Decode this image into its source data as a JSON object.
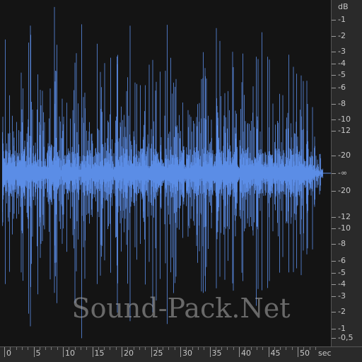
{
  "colors": {
    "waveform": "#5b8de6",
    "background": "#141414",
    "ruler": "#2a2a2a"
  },
  "db_ruler": {
    "unit": "dB",
    "labels": [
      "-1",
      "-2",
      "-3",
      "-4",
      "-5",
      "-6",
      "-8",
      "-10",
      "-12",
      "-20",
      "-∞",
      "-20",
      "-12",
      "-10",
      "-8",
      "-6",
      "-5",
      "-4",
      "-3",
      "-2",
      "-1",
      "-0,5"
    ]
  },
  "time_ruler": {
    "unit": "sec",
    "labels": [
      "0",
      "5",
      "10",
      "15",
      "20",
      "25",
      "30",
      "35",
      "40",
      "45",
      "50"
    ]
  },
  "waveform": {
    "duration_sec": 53,
    "channels": 1
  },
  "watermark": "Sound-Pack.Net"
}
